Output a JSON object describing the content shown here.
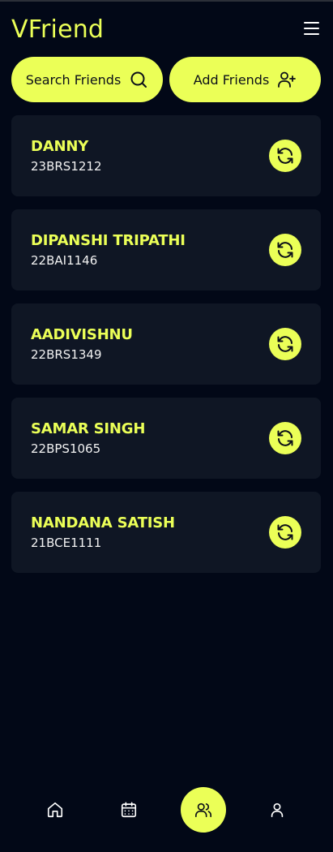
{
  "header": {
    "title": "VFriend",
    "menu_icon": "hamburger-menu-icon"
  },
  "actions": {
    "search_label": "Search Friends",
    "search_icon": "search-icon",
    "add_label": "Add Friends",
    "add_icon": "user-plus-icon"
  },
  "friends": [
    {
      "name": "DANNY",
      "reg": "23BRS1212"
    },
    {
      "name": "DIPANSHI TRIPATHI",
      "reg": "22BAI1146"
    },
    {
      "name": "AADIVISHNU",
      "reg": "22BRS1349"
    },
    {
      "name": "SAMAR SINGH",
      "reg": "22BPS1065"
    },
    {
      "name": "NANDANA SATISH",
      "reg": "21BCE1111"
    }
  ],
  "bottom_nav": {
    "items": [
      "home-icon",
      "calendar-icon",
      "users-icon",
      "user-icon"
    ],
    "active": "users-icon"
  },
  "colors": {
    "accent": "#ebff57",
    "background": "#020817",
    "card": "#0f1624"
  }
}
